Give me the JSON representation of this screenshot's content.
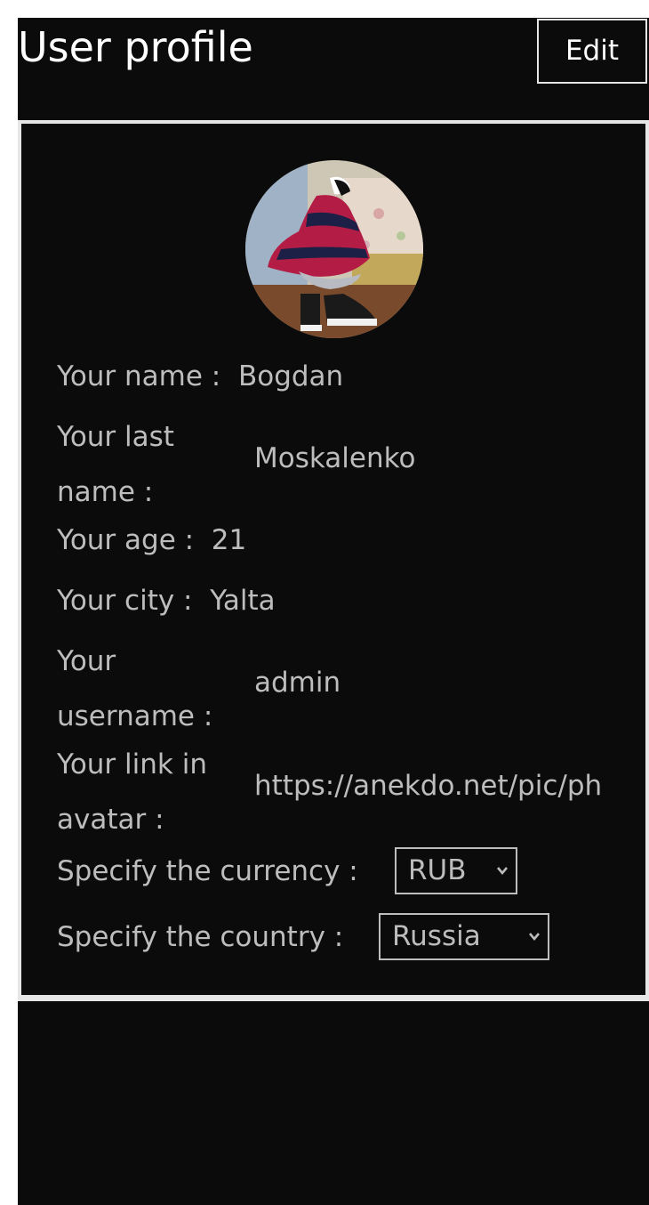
{
  "header": {
    "title": "User profile",
    "edit_label": "Edit"
  },
  "profile": {
    "name_label": "Your name :",
    "name_value": "Bogdan",
    "last_name_label": "Your last name :",
    "last_name_value": "Moskalenko",
    "age_label": "Your age :",
    "age_value": "21",
    "city_label": "Your city :",
    "city_value": "Yalta",
    "username_label": "Your username :",
    "username_value": "admin",
    "avatar_link_label": "Your link in avatar :",
    "avatar_link_value": "https://anekdo.net/pic/ph",
    "currency_label": "Specify the currency :",
    "currency_selected": "RUB",
    "country_label": "Specify the country :",
    "country_selected": "Russia"
  },
  "icons": {
    "select_arrow": "chevron-down-icon"
  },
  "colors": {
    "background": "#0b0b0b",
    "text": "#bdbdbd",
    "title": "#ffffff",
    "border": "#e6e6e6"
  }
}
